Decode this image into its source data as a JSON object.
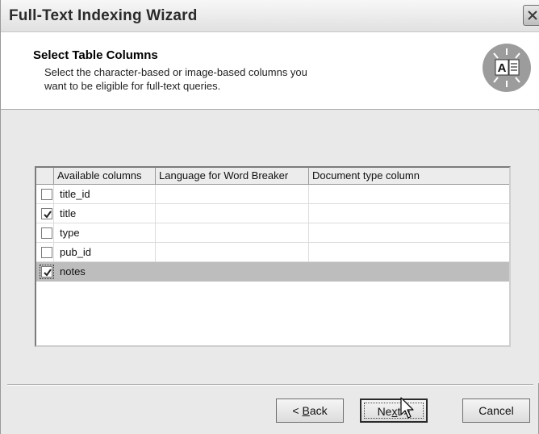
{
  "window": {
    "title": "Full-Text Indexing Wizard"
  },
  "header": {
    "title": "Select Table Columns",
    "description_line1": "Select the character-based or image-based columns you",
    "description_line2": "want to be eligible for full-text queries."
  },
  "grid": {
    "columns": [
      "Available columns",
      "Language for Word Breaker",
      "Document type column"
    ],
    "rows": [
      {
        "name": "title_id",
        "checked": false,
        "language": "",
        "doc_type": ""
      },
      {
        "name": "title",
        "checked": true,
        "language": "",
        "doc_type": ""
      },
      {
        "name": "type",
        "checked": false,
        "language": "",
        "doc_type": ""
      },
      {
        "name": "pub_id",
        "checked": false,
        "language": "",
        "doc_type": ""
      },
      {
        "name": "notes",
        "checked": true,
        "language": "",
        "doc_type": "",
        "selected": true
      }
    ]
  },
  "buttons": {
    "back": "< Back",
    "back_mnemonic": "B",
    "next": "Next >",
    "next_mnemonic": "x",
    "cancel": "Cancel"
  },
  "icons": {
    "close": "close-icon",
    "wizard": "fulltext-index-icon",
    "cursor": "mouse-pointer-icon",
    "checkmark": "checkmark-icon"
  },
  "colors": {
    "selection": "#bdbdbd",
    "window_bg": "#e9e9e9",
    "header_bg": "#ffffff"
  }
}
